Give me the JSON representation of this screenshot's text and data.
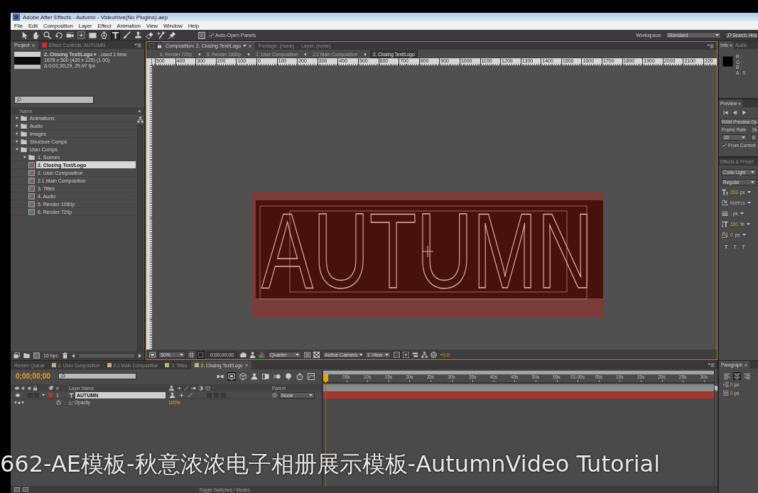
{
  "window": {
    "title": "Adobe After Effects - Autumn - Videohive(No Plugins).aep"
  },
  "menu": [
    "File",
    "Edit",
    "Composition",
    "Layer",
    "Effect",
    "Animation",
    "View",
    "Window",
    "Help"
  ],
  "toolbar": {
    "tools": [
      {
        "kind": "select",
        "selected": false
      },
      {
        "kind": "hand",
        "selected": false
      },
      {
        "kind": "zoom",
        "selected": false
      },
      {
        "kind": "rotate",
        "selected": false
      },
      {
        "kind": "orbit",
        "selected": false
      },
      {
        "kind": "pan",
        "selected": false
      },
      {
        "kind": "rect",
        "selected": false
      },
      {
        "kind": "pen",
        "selected": false
      },
      {
        "kind": "text",
        "selected": true
      },
      {
        "kind": "brush",
        "selected": false
      },
      {
        "kind": "stamp",
        "selected": false
      },
      {
        "kind": "eraser",
        "selected": false
      },
      {
        "kind": "roto",
        "selected": false
      },
      {
        "kind": "pin",
        "selected": false
      }
    ],
    "auto_open_panels": {
      "label": "Auto-Open Panels",
      "checked": true
    },
    "workspace": {
      "label": "Workspace:",
      "value": "Standard"
    },
    "search_help": {
      "placeholder": "Search Help"
    }
  },
  "project_panel": {
    "tabs": [
      {
        "label": "Project",
        "kind": "project",
        "selected": true
      },
      {
        "label": "Effect Controls: AUTUMN",
        "kind": "effect_controls",
        "selected": false
      }
    ],
    "summary": {
      "title": "**2. Closing Text/Logo** ▾ , used 1 time",
      "size": "1678 x 500  (420 x 125) (1.00)",
      "duration": "Δ 0;01;30;29, 29.97 fps"
    },
    "column": "Name",
    "items": [
      {
        "kind": "folder",
        "name": "Animations",
        "expanded": false,
        "selected": false
      },
      {
        "kind": "folder",
        "name": "Audio",
        "expanded": false,
        "selected": false
      },
      {
        "kind": "folder",
        "name": "Images",
        "expanded": false,
        "selected": false
      },
      {
        "kind": "folder",
        "name": "Structure Comps",
        "expanded": false,
        "selected": false
      },
      {
        "kind": "folder",
        "name": "User Comps",
        "expanded": true,
        "selected": false,
        "children": [
          {
            "kind": "folder",
            "name": "1. Scenes",
            "expanded": false,
            "selected": false
          },
          {
            "kind": "comp",
            "name": "2. Closing Text/Logo",
            "selected": true
          },
          {
            "kind": "comp",
            "name": "2. User Composition",
            "selected": false
          },
          {
            "kind": "comp",
            "name": "2.1 Main Composition",
            "selected": false
          },
          {
            "kind": "comp",
            "name": "3. Titles",
            "selected": false
          },
          {
            "kind": "comp",
            "name": "4. Audio",
            "selected": false
          },
          {
            "kind": "comp",
            "name": "5. Render 1080p",
            "selected": false
          },
          {
            "kind": "comp",
            "name": "6. Render 720p",
            "selected": false
          }
        ]
      }
    ],
    "bit_depth": "16 bpc"
  },
  "composition_panel": {
    "tabs": [
      {
        "label": "Composition: 2. Closing Text/Logo",
        "kind": "composition",
        "selected": true
      },
      {
        "label": "Footage: (none)",
        "kind": "footage",
        "selected": false
      },
      {
        "label": "Layer: (none)",
        "kind": "layer",
        "selected": false
      }
    ],
    "breadcrumbs": [
      {
        "label": "6. Render 720p",
        "selected": false
      },
      {
        "label": "5. Render 1080p",
        "selected": false
      },
      {
        "label": "2. User Composition",
        "selected": false
      },
      {
        "label": "2.1 Main Composition",
        "selected": false
      },
      {
        "label": "2. Closing Text/Logo",
        "selected": true
      }
    ],
    "ruler": [
      "500",
      "400",
      "300",
      "200",
      "100",
      "0",
      "100",
      "200",
      "300",
      "400",
      "500",
      "600",
      "700",
      "800",
      "900",
      "1000",
      "1100",
      "1200",
      "1300",
      "1400",
      "1500",
      "1600",
      "1700",
      "1800",
      "1900",
      "2000",
      "2100",
      "220"
    ],
    "canvas": {
      "text": "AUTUMN"
    },
    "controls": [
      {
        "kind": "preview",
        "on": false
      },
      {
        "kind": "magnification",
        "label": "50%",
        "on": false
      },
      {
        "kind": "grid",
        "on": false
      },
      {
        "kind": "roi",
        "on": true
      },
      {
        "kind": "timecode",
        "label": "0;00;00;00",
        "on": false
      },
      {
        "kind": "camera",
        "on": false
      },
      {
        "kind": "person",
        "on": false
      },
      {
        "kind": "channels",
        "on": false
      },
      {
        "kind": "resolution",
        "label": "Quarter",
        "on": false
      },
      {
        "kind": "fastprev",
        "on": false
      },
      {
        "kind": "checker",
        "on": false
      },
      {
        "kind": "camera_view",
        "label": "Active Camera",
        "on": false
      },
      {
        "kind": "views",
        "label": "1 View",
        "on": false
      },
      {
        "kind": "panes",
        "on": true
      },
      {
        "kind": "pixel",
        "on": true
      },
      {
        "kind": "tlbar",
        "on": false
      },
      {
        "kind": "flow",
        "on": false
      },
      {
        "kind": "shutter",
        "on": false
      },
      {
        "kind": "exposure",
        "label": "+0.0",
        "on": false
      }
    ]
  },
  "info_panel": {
    "tabs": [
      {
        "label": "Info",
        "selected": true
      },
      {
        "label": "Audio",
        "selected": false
      }
    ],
    "channels": [
      "R :",
      "G :",
      "B :",
      "A : 0"
    ]
  },
  "preview_panel": {
    "tabs": [
      {
        "label": "Preview",
        "selected": true
      }
    ],
    "ram_preview": "RAM Preview Op",
    "frame_rate_label": "Frame Rate",
    "skip_label": "Sk",
    "frame_rate": "30",
    "skip": "0",
    "from_current": {
      "label": "From Current",
      "checked": true
    }
  },
  "character_panel": {
    "tabs": [
      {
        "label": "Effects & Preset",
        "selected": false
      }
    ],
    "font": "Code Light",
    "style": "Regular",
    "rows": [
      {
        "kind": "size",
        "value": "253",
        "unit": "px",
        "disabled": false
      },
      {
        "kind": "tracking",
        "value": "Metrics",
        "disabled": true
      },
      {
        "kind": "stroke",
        "unit": "- px",
        "disabled": false
      },
      {
        "kind": "scale",
        "value": "100",
        "unit": "%",
        "disabled": false
      },
      {
        "kind": "baseline",
        "value": "0",
        "unit": "px",
        "disabled": false
      }
    ],
    "style_buttons": [
      {
        "label": "T",
        "kind": "bold"
      },
      {
        "label": "T",
        "kind": "italic"
      },
      {
        "label": "T",
        "kind": "caps"
      }
    ]
  },
  "timeline": {
    "tabs": [
      {
        "label": "Render Queue",
        "kind": "queue",
        "selected": false
      },
      {
        "label": "2. User Composition",
        "kind": "comp",
        "selected": false
      },
      {
        "label": "2.1 Main Composition",
        "kind": "comp",
        "selected": false
      },
      {
        "label": "3. Titles",
        "kind": "comp",
        "selected": false
      },
      {
        "label": "2. Closing Text/Logo",
        "kind": "comp",
        "selected": true
      }
    ],
    "timecode": "0;00;00;00",
    "tools": [
      {
        "kind": "minif",
        "on": false
      },
      {
        "kind": "live",
        "on": true
      },
      {
        "kind": "cube",
        "on": false
      },
      {
        "kind": "shy",
        "on": false
      },
      {
        "kind": "blend",
        "on": false
      },
      {
        "kind": "mblur",
        "on": false
      },
      {
        "kind": "balloon",
        "on": false
      },
      {
        "kind": "stopwatch",
        "on": false
      },
      {
        "kind": "graph",
        "on": false
      }
    ],
    "columns": {
      "number": "#",
      "name": "Layer Name",
      "parent": "Parent"
    },
    "layers": [
      {
        "number": "1",
        "name": "AUTUMN",
        "color": "#c12f28",
        "selected": true,
        "expanded": true,
        "parent": "None",
        "av_switches": [
          {
            "kind": "video",
            "on": true
          },
          {
            "kind": "solo",
            "on": false
          },
          {
            "kind": "lock",
            "on": false
          }
        ],
        "layer_switches": [
          {
            "kind": "shy",
            "on": true
          },
          {
            "kind": "collapse",
            "on": true
          },
          {
            "kind": "quality",
            "on": true
          },
          {
            "kind": "motion_blur",
            "on": false
          },
          {
            "kind": "adjustment",
            "on": false
          },
          {
            "kind": "three_d",
            "on": false
          }
        ],
        "properties": [
          {
            "name": "Opacity",
            "value": "100%"
          }
        ]
      }
    ],
    "ruler": [
      "05s",
      "10s",
      "15s",
      "20s",
      "25s",
      "30s",
      "35s",
      "40s",
      "45s",
      "50s",
      "55s",
      "01:00s",
      "05s",
      "10s",
      "15s",
      "20s",
      "25s",
      "30s"
    ],
    "footer": "Toggle Switches / Modes"
  },
  "paragraph_panel": {
    "tabs": [
      {
        "label": "Paragraph",
        "selected": true
      }
    ],
    "alignment": [
      {
        "kind": "align_left",
        "selected": false
      },
      {
        "kind": "align_center",
        "selected": true
      },
      {
        "kind": "align_right",
        "selected": false
      }
    ],
    "indents": [
      {
        "kind": "indent_left",
        "value": "0",
        "unit": "px"
      },
      {
        "kind": "indent_first",
        "value": "0",
        "unit": "px"
      }
    ]
  },
  "caption": "662-AE模板-秋意浓浓电子相册展示模板-AutumnVideo Tutorial"
}
